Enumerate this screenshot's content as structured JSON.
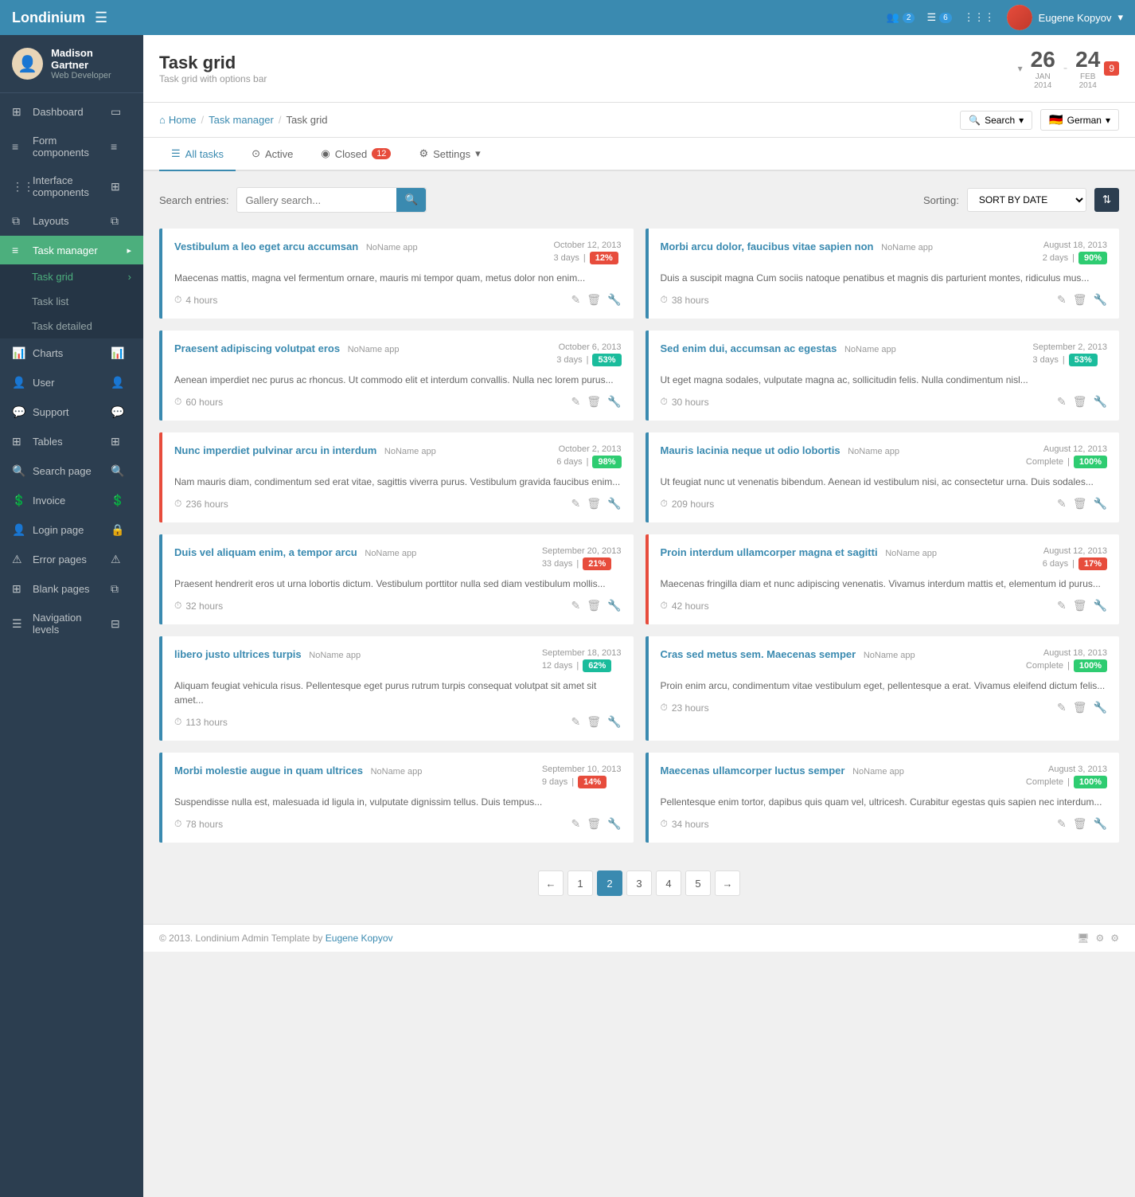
{
  "app": {
    "brand": "Londinium",
    "menu_icon": "☰"
  },
  "topnav": {
    "users_count": "2",
    "lists_count": "6",
    "grid_icon": "⋮⋮⋮",
    "user_name": "Eugene Kopyov",
    "user_dropdown": "▾"
  },
  "sidebar": {
    "user": {
      "name": "Madison Gartner",
      "role": "Web Developer"
    },
    "items": [
      {
        "id": "dashboard",
        "label": "Dashboard",
        "icon": "⊞"
      },
      {
        "id": "form-components",
        "label": "Form components",
        "icon": "≡"
      },
      {
        "id": "interface-components",
        "label": "Interface components",
        "icon": "⋮⋮⋮"
      },
      {
        "id": "layouts",
        "label": "Layouts",
        "icon": "⧉"
      },
      {
        "id": "task-manager",
        "label": "Task manager",
        "icon": "≡",
        "active": true
      },
      {
        "id": "charts",
        "label": "Charts",
        "icon": "📊"
      },
      {
        "id": "user",
        "label": "User",
        "icon": "👤"
      },
      {
        "id": "support",
        "label": "Support",
        "icon": "💬"
      },
      {
        "id": "tables",
        "label": "Tables",
        "icon": "⊞"
      },
      {
        "id": "search-page",
        "label": "Search page",
        "icon": "🔍"
      },
      {
        "id": "invoice",
        "label": "Invoice",
        "icon": "💲"
      },
      {
        "id": "login-page",
        "label": "Login page",
        "icon": "👤"
      },
      {
        "id": "error-pages",
        "label": "Error pages",
        "icon": "⚠"
      },
      {
        "id": "blank-pages",
        "label": "Blank pages",
        "icon": "⊞"
      },
      {
        "id": "navigation-levels",
        "label": "Navigation levels",
        "icon": "☰"
      }
    ],
    "task_sub": [
      {
        "id": "task-grid",
        "label": "Task grid",
        "active": true
      },
      {
        "id": "task-list",
        "label": "Task list"
      },
      {
        "id": "task-detailed",
        "label": "Task detailed"
      }
    ]
  },
  "header": {
    "title": "Task grid",
    "subtitle": "Task grid with options bar",
    "date_from_num": "26",
    "date_from_month": "JAN",
    "date_from_year": "2014",
    "date_to_num": "24",
    "date_to_month": "FEB",
    "date_to_year": "2014",
    "date_badge": "9",
    "date_dropdown": "▾"
  },
  "breadcrumb": {
    "home": "Home",
    "task_manager": "Task manager",
    "current": "Task grid",
    "search_label": "Search",
    "language_label": "German",
    "search_icon": "🔍",
    "flag": "🇩🇪"
  },
  "tabs": [
    {
      "id": "all-tasks",
      "label": "All tasks",
      "icon": "☰",
      "active": true
    },
    {
      "id": "active",
      "label": "Active",
      "icon": "⊙"
    },
    {
      "id": "closed",
      "label": "Closed",
      "icon": "◉",
      "badge": "12"
    },
    {
      "id": "settings",
      "label": "Settings",
      "icon": "⚙",
      "dropdown": true
    }
  ],
  "searchbar": {
    "label": "Search entries:",
    "placeholder": "Gallery search...",
    "search_btn": "🔍",
    "sort_label": "Sorting:",
    "sort_value": "SORT BY DATE",
    "sort_icon": "⇅"
  },
  "tasks": [
    {
      "id": 1,
      "title": "Vestibulum a leo eget arcu accumsan",
      "app": "NoName app",
      "date": "October 12, 2013",
      "days": "3 days",
      "progress": "12%",
      "progress_type": "red",
      "body": "Maecenas mattis, magna vel fermentum ornare, mauris mi tempor quam, metus dolor non enim...",
      "hours": "4 hours",
      "border": "blue"
    },
    {
      "id": 2,
      "title": "Morbi arcu dolor, faucibus vitae sapien non",
      "app": "NoName app",
      "date": "August 18, 2013",
      "days": "2 days",
      "progress": "90%",
      "progress_type": "green",
      "body": "Duis a suscipit magna Cum sociis natoque penatibus et magnis dis parturient montes, ridiculus mus...",
      "hours": "38 hours",
      "border": "blue"
    },
    {
      "id": 3,
      "title": "Praesent adipiscing volutpat eros",
      "app": "NoName app",
      "date": "October 6, 2013",
      "days": "3 days",
      "progress": "53%",
      "progress_type": "teal",
      "body": "Aenean imperdiet nec purus ac rhoncus. Ut commodo elit et interdum convallis. Nulla nec lorem purus...",
      "hours": "60 hours",
      "border": "blue"
    },
    {
      "id": 4,
      "title": "Sed enim dui, accumsan ac egestas",
      "app": "NoName app",
      "date": "September 2, 2013",
      "days": "3 days",
      "progress": "53%",
      "progress_type": "teal",
      "body": "Ut eget magna sodales, vulputate magna ac, sollicitudin felis. Nulla condimentum nisl...",
      "hours": "30 hours",
      "border": "blue"
    },
    {
      "id": 5,
      "title": "Nunc imperdiet pulvinar arcu in interdum",
      "app": "NoName app",
      "date": "October 2, 2013",
      "days": "6 days",
      "progress": "98%",
      "progress_type": "green",
      "body": "Nam mauris diam, condimentum sed erat vitae, sagittis viverra purus. Vestibulum gravida faucibus enim...",
      "hours": "236 hours",
      "border": "red"
    },
    {
      "id": 6,
      "title": "Mauris lacinia neque ut odio lobortis",
      "app": "NoName app",
      "date": "August 12, 2013",
      "days_label": "Complete",
      "progress": "100%",
      "progress_type": "green",
      "body": "Ut feugiat nunc ut venenatis bibendum. Aenean id vestibulum nisi, ac consectetur urna. Duis sodales...",
      "hours": "209 hours",
      "border": "blue"
    },
    {
      "id": 7,
      "title": "Duis vel aliquam enim, a tempor arcu",
      "app": "NoName app",
      "date": "September 20, 2013",
      "days": "33 days",
      "progress": "21%",
      "progress_type": "red",
      "body": "Praesent hendrerit eros ut urna lobortis dictum. Vestibulum porttitor nulla sed diam vestibulum mollis...",
      "hours": "32 hours",
      "border": "blue"
    },
    {
      "id": 8,
      "title": "Proin interdum ullamcorper magna et sagitti",
      "app": "NoName app",
      "date": "August 12, 2013",
      "days": "6 days",
      "progress": "17%",
      "progress_type": "red",
      "body": "Maecenas fringilla diam et nunc adipiscing venenatis. Vivamus interdum mattis et, elementum id purus...",
      "hours": "42 hours",
      "border": "red"
    },
    {
      "id": 9,
      "title": "libero justo ultrices turpis",
      "app": "NoName app",
      "date": "September 18, 2013",
      "days": "12 days",
      "progress": "62%",
      "progress_type": "teal",
      "body": "Aliquam feugiat vehicula risus. Pellentesque eget purus rutrum turpis consequat volutpat sit amet sit amet...",
      "hours": "113 hours",
      "border": "blue"
    },
    {
      "id": 10,
      "title": "Cras sed metus sem. Maecenas semper",
      "app": "NoName app",
      "date": "August 18, 2013",
      "days_label": "Complete",
      "progress": "100%",
      "progress_type": "green",
      "body": "Proin enim arcu, condimentum vitae vestibulum eget, pellentesque a erat. Vivamus eleifend dictum felis...",
      "hours": "23 hours",
      "border": "blue"
    },
    {
      "id": 11,
      "title": "Morbi molestie augue in quam ultrices",
      "app": "NoName app",
      "date": "September 10, 2013",
      "days": "9 days",
      "progress": "14%",
      "progress_type": "red",
      "body": "Suspendisse nulla est, malesuada id ligula in, vulputate dignissim tellus. Duis tempus...",
      "hours": "78 hours",
      "border": "blue"
    },
    {
      "id": 12,
      "title": "Maecenas ullamcorper luctus semper",
      "app": "NoName app",
      "date": "August 3, 2013",
      "days_label": "Complete",
      "progress": "100%",
      "progress_type": "green",
      "body": "Pellentesque enim tortor, dapibus quis quam vel, ultricesh. Curabitur egestas quis sapien nec interdum...",
      "hours": "34 hours",
      "border": "blue"
    }
  ],
  "pagination": {
    "prev": "←",
    "next": "→",
    "pages": [
      "1",
      "2",
      "3",
      "4",
      "5"
    ],
    "current": "2"
  },
  "footer": {
    "text": "© 2013. Londinium Admin Template by",
    "link_text": "Eugene Kopyov"
  }
}
